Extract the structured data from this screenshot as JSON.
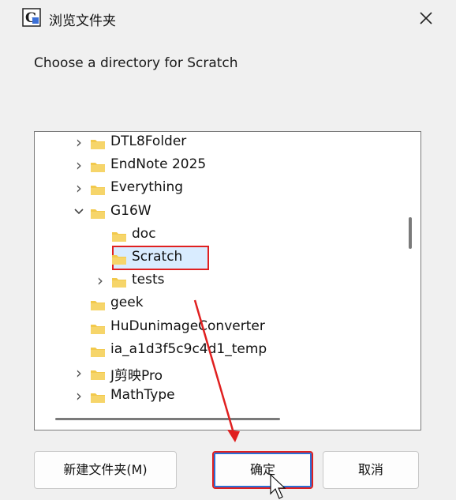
{
  "window": {
    "title": "浏览文件夹",
    "app_icon": "app-logo-icon",
    "close_icon": "close-icon"
  },
  "prompt": "Choose a directory for Scratch",
  "tree": {
    "items": [
      {
        "label": "DTL8Folder",
        "depth": 1,
        "expander": "chevron-right"
      },
      {
        "label": "EndNote 2025",
        "depth": 1,
        "expander": "chevron-right"
      },
      {
        "label": "Everything",
        "depth": 1,
        "expander": "chevron-right"
      },
      {
        "label": "G16W",
        "depth": 1,
        "expander": "chevron-down"
      },
      {
        "label": "doc",
        "depth": 2,
        "expander": "none"
      },
      {
        "label": "Scratch",
        "depth": 2,
        "expander": "none",
        "selected": true
      },
      {
        "label": "tests",
        "depth": 2,
        "expander": "chevron-right"
      },
      {
        "label": "geek",
        "depth": 1,
        "expander": "none"
      },
      {
        "label": "HuDunimageConverter",
        "depth": 1,
        "expander": "none"
      },
      {
        "label": "ia_a1d3f5c9c4d1_temp",
        "depth": 1,
        "expander": "none"
      },
      {
        "label": "J剪映Pro",
        "depth": 1,
        "expander": "chevron-right"
      },
      {
        "label": "MathType",
        "depth": 1,
        "expander": "chevron-right"
      }
    ]
  },
  "buttons": {
    "new_folder": "新建文件夹(M)",
    "ok": "确定",
    "cancel": "取消"
  },
  "colors": {
    "folder": "#f2c94c",
    "annotation_red": "#e02020",
    "selection_bg": "#d9ecff"
  }
}
